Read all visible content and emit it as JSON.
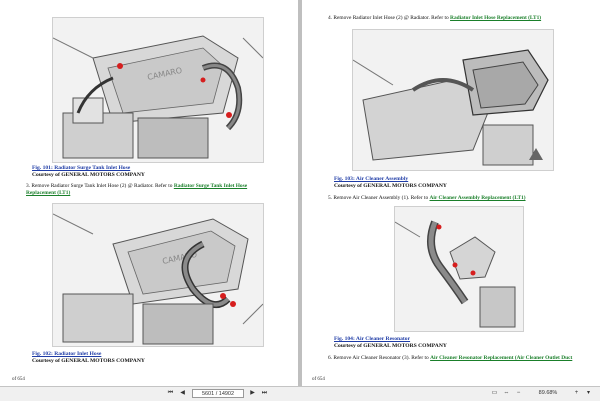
{
  "left_page": {
    "fig101": {
      "title": "Fig. 101: Radiator Surge Tank Inlet Hose",
      "credit": "Courtesy of GENERAL MOTORS COMPANY"
    },
    "step3": {
      "text": "3. Remove Radiator Surge Tank Inlet Hose (2) @ Radiator. Refer to",
      "link": "Radiator Surge Tank Inlet Hose Replacement (LT1)"
    },
    "fig102": {
      "title": "Fig. 102: Radiator Inlet Hose",
      "credit": "Courtesy of GENERAL MOTORS COMPANY"
    },
    "footer": "of 654"
  },
  "right_page": {
    "step4": {
      "text": "4. Remove Radiator Inlet Hose (2) @ Radiator. Refer to",
      "link": "Radiator Inlet Hose Replacement (LT1)"
    },
    "fig103": {
      "title": "Fig. 103: Air Cleaner Assembly",
      "credit": "Courtesy of GENERAL MOTORS COMPANY"
    },
    "step5": {
      "text": "5. Remove Air Cleaner Assembly (1). Refer to",
      "link": "Air Cleaner Assembly Replacement (LT1)"
    },
    "fig104": {
      "title": "Fig. 104: Air Cleaner Resonator",
      "credit": "Courtesy of GENERAL MOTORS COMPANY"
    },
    "step6": {
      "text": "6. Remove Air Cleaner Resonator (3). Refer to",
      "link": "Air Cleaner Resonator Replacement (Air Cleaner Outlet Duct"
    },
    "footer": "of 654"
  },
  "toolbar": {
    "page_indicator": "5601 / 14902",
    "zoom": "89.68%"
  },
  "colors": {
    "link_blue": "#1f3ca6",
    "link_green": "#1a7f2a",
    "highlight_red": "#d61e1e"
  }
}
